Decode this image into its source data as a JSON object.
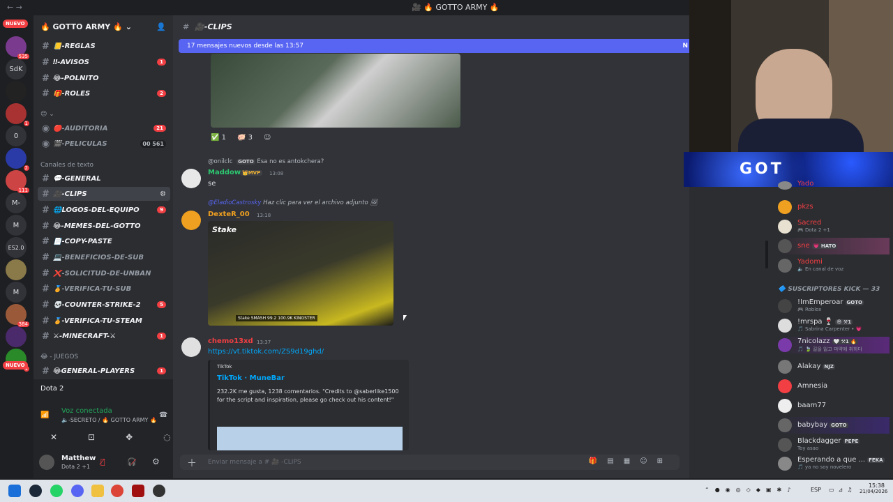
{
  "window": {
    "title": "🎥 🔥 GOTTO ARMY 🔥",
    "nav": "←  →"
  },
  "rail": {
    "new_top": "NUEVO",
    "new_bottom": "NUEVO",
    "servers": [
      {
        "label": "",
        "badge": "535"
      },
      {
        "label": "SdK",
        "badge": ""
      },
      {
        "label": "",
        "badge": ""
      },
      {
        "label": "",
        "badge": "1"
      },
      {
        "label": "0",
        "badge": ""
      },
      {
        "label": "",
        "badge": "2"
      },
      {
        "label": "",
        "badge": "111"
      },
      {
        "label": "M-",
        "badge": ""
      },
      {
        "label": "M",
        "badge": ""
      },
      {
        "label": "ES2.0",
        "badge": ""
      },
      {
        "label": "",
        "badge": ""
      },
      {
        "label": "M",
        "badge": ""
      },
      {
        "label": "",
        "badge": "384"
      },
      {
        "label": "",
        "badge": ""
      },
      {
        "label": "",
        "badge": "1"
      }
    ]
  },
  "server": {
    "name": "🔥 GOTTO ARMY 🔥"
  },
  "channels_top": [
    {
      "label": "📒-REGLAS",
      "count": "",
      "unread": false
    },
    {
      "label": "‼-AVISOS",
      "count": "1",
      "unread": true
    },
    {
      "label": "😂-POLNITO",
      "count": "",
      "unread": true
    },
    {
      "label": "🎁-ROLES",
      "count": "2",
      "unread": true
    }
  ],
  "cat_emoji": "😊 ⌄",
  "voice_channels": [
    {
      "label": "🔴-AUDITORIA",
      "count": "21"
    },
    {
      "label": "🎬-PELICULAS",
      "count": "00  561"
    }
  ],
  "text_category": "Canales de texto",
  "channels_text": [
    {
      "label": "💬-GENERAL",
      "count": "",
      "unread": true,
      "active": false
    },
    {
      "label": "🎥-CLIPS",
      "count": "",
      "unread": true,
      "active": true
    },
    {
      "label": "🌐LOGOS-DEL-EQUIPO",
      "count": "9",
      "unread": true,
      "active": false
    },
    {
      "label": "😂-MEMES-DEL-GOTTO",
      "count": "",
      "unread": true,
      "active": false
    },
    {
      "label": "📄-COPY-PASTE",
      "count": "",
      "unread": true,
      "active": false
    },
    {
      "label": "💻-BENEFICIOS-DE-SUB",
      "count": "",
      "unread": false,
      "active": false
    },
    {
      "label": "❌-SOLICITUD-DE-UNBAN",
      "count": "",
      "unread": false,
      "active": false
    },
    {
      "label": "🏅-VERIFICA-TU-SUB",
      "count": "",
      "unread": false,
      "active": false
    },
    {
      "label": "💀-COUNTER-STRIKE-2",
      "count": "5",
      "unread": true,
      "active": false
    },
    {
      "label": "🏅-VERIFICA-TU-STEAM",
      "count": "",
      "unread": true,
      "active": false
    },
    {
      "label": "⚔-MINECRAFT-⚔",
      "count": "1",
      "unread": true,
      "active": false
    }
  ],
  "games_category": "😂 - JUEGOS",
  "channel_games": {
    "label": "😂GENERAL-PLAYERS",
    "count": "1"
  },
  "voice_panel": {
    "game": "Dota 2",
    "status": "Voz conectada",
    "location": "🔈-SECRETO / 🔥 GOTTO ARMY 🔥",
    "user": "Matthew",
    "user_status": "Dota 2 +1"
  },
  "chat": {
    "channel": "🎥-CLIPS",
    "new_messages": "17 mensajes nuevos desde las 13:57",
    "new_marker": "N",
    "reactions": [
      {
        "emoji": "✅",
        "count": "1"
      },
      {
        "emoji": "🐖",
        "count": "3"
      }
    ],
    "messages": [
      {
        "reply_user": "@onilclc",
        "reply_tag": "GOTO",
        "reply_text": "Esa no es antokchera?",
        "author": "Maddow",
        "role": "👑MVP",
        "time": "13:08",
        "text": "se"
      },
      {
        "reply_user": "@EladioCastrosky",
        "reply_text": "Haz clic para ver el archivo adjunto",
        "author": "DexteR_00",
        "time": "13:18",
        "image_caption": "Stake   SMASH 99.2   100.9K  KINGSTER"
      },
      {
        "author": "chemo13xd",
        "time": "13:37",
        "link": "https://vt.tiktok.com/ZS9d19ghd/",
        "embed_provider": "TikTok",
        "embed_title": "TikTok · MuneBar",
        "embed_desc": "232.2K me gusta, 1238 comentarios. \"Credits to @saberlike1500 for the script and inspiration, please go check out his content!\""
      }
    ],
    "composer_placeholder": "Enviar mensaje a # 🎥 -CLIPS"
  },
  "banner_text": "GOT",
  "members": [
    {
      "name": "Yado",
      "status": "",
      "tag": "",
      "color": "#f23f43"
    },
    {
      "name": "pkzs",
      "status": "",
      "tag": "",
      "color": "#f23f43"
    },
    {
      "name": "Sacred",
      "status": "🎮 Dota 2 +1",
      "tag": "",
      "color": "#f23f43"
    },
    {
      "name": "sne",
      "status": "",
      "tag": "💗 HATO",
      "color": "#f23f43"
    },
    {
      "name": "Yadomi",
      "status": "🔈 En canal de voz",
      "tag": "",
      "color": "#f23f43"
    }
  ],
  "members_category": "🔷 SUSCRIPTORES KICK — 33",
  "subs": [
    {
      "name": "!ImEmperoar",
      "status": "🎮 Roblox",
      "tag": "GOTO"
    },
    {
      "name": "!mrspa 🍷",
      "status": "🎵 Sabrina Carpenter • 💗",
      "tag": "😎 ⚒1"
    },
    {
      "name": "7nicolazz",
      "status": "🎵 🍃 길을 잃고 마약에 취하다",
      "tag": "🤍 ⚒1 🔥"
    },
    {
      "name": "Alakay",
      "status": "",
      "tag": "NJZ"
    },
    {
      "name": "Amnesia",
      "status": "",
      "tag": ""
    },
    {
      "name": "baam77",
      "status": "",
      "tag": ""
    },
    {
      "name": "babybay",
      "status": "",
      "tag": "GOTO"
    },
    {
      "name": "Blackdagger",
      "status": "Toy asao",
      "tag": "PEPE"
    },
    {
      "name": "Esperando a que ...",
      "status": "🎵 ya no soy novelero",
      "tag": "FEKA"
    }
  ],
  "taskbar": {
    "lang": "ESP",
    "time": "15:38",
    "date": "21/04/2026"
  },
  "colors": {
    "accent": "#5865f2",
    "danger": "#f23f43",
    "online": "#23a55a"
  }
}
